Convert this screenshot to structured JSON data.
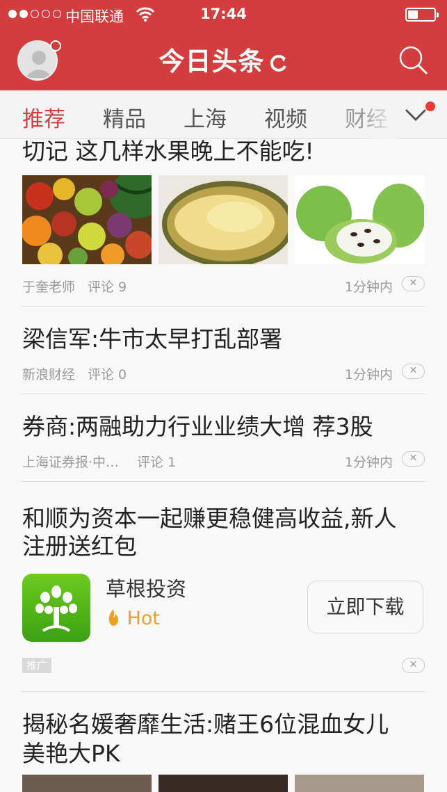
{
  "status_bar": {
    "carrier": "中国联通",
    "time": "17:44"
  },
  "header": {
    "logo": "今日头条"
  },
  "tabs": [
    {
      "label": "推荐",
      "active": true
    },
    {
      "label": "精品"
    },
    {
      "label": "上海"
    },
    {
      "label": "视频"
    },
    {
      "label": "财经"
    }
  ],
  "feed": [
    {
      "title": "切记 这几样水果晚上不能吃!",
      "images": [
        "assorted-fruits",
        "durian",
        "custard-apple"
      ],
      "source": "于奎老师",
      "comments": "评论 9",
      "time": "1分钟内"
    },
    {
      "title": "梁信军:牛市太早打乱部署",
      "source": "新浪财经",
      "comments": "评论 0",
      "time": "1分钟内"
    },
    {
      "title": "券商:两融助力行业业绩大增 荐3股",
      "source": "上海证券报·中…",
      "comments": "评论 1",
      "time": "1分钟内"
    }
  ],
  "ad": {
    "title_line1": "和顺为资本一起赚更稳健高收益,新人",
    "title_line2": "注册送红包",
    "app_name": "草根投资",
    "hot_label": "Hot",
    "download_label": "立即下载",
    "promo_tag": "推广"
  },
  "last_item": {
    "title_line1": "揭秘名媛奢靡生活:赌王6位混血女儿",
    "title_line2": "美艳大PK"
  },
  "dismiss_glyph": "✕",
  "colors": {
    "brand_red": "#d43d3d",
    "hot_orange": "#f0a020",
    "app_icon_green": "#4cb31a"
  }
}
